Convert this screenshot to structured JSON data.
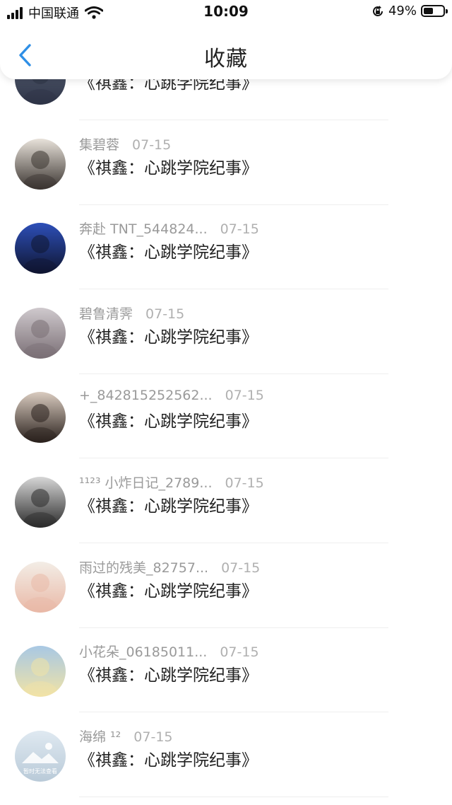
{
  "status_bar": {
    "carrier": "中国联通",
    "time": "10:09",
    "battery_percent": "49%",
    "battery_level": 0.49
  },
  "header": {
    "title": "收藏",
    "back_icon": "chevron-left-icon"
  },
  "items": [
    {
      "message": "《祺鑫：心跳学院纪事》",
      "avatar_colors": [
        "#5a6378",
        "#2e3446"
      ]
    },
    {
      "name": "集碧蓉",
      "date": "07-15",
      "message": "《祺鑫：心跳学院纪事》",
      "avatar_colors": [
        "#e8e2da",
        "#3a3430"
      ]
    },
    {
      "name": "奔赴 TNT_544824...",
      "date": "07-15",
      "message": "《祺鑫：心跳学院纪事》",
      "avatar_colors": [
        "#2d4fb8",
        "#0f1530"
      ]
    },
    {
      "name": "碧鲁清霁",
      "date": "07-15",
      "message": "《祺鑫：心跳学院纪事》",
      "avatar_colors": [
        "#cfc9cd",
        "#7a6f75"
      ]
    },
    {
      "name": "+_842815252562...",
      "date": "07-15",
      "message": "《祺鑫：心跳学院纪事》",
      "avatar_colors": [
        "#d9cbbf",
        "#2a211d"
      ]
    },
    {
      "name": "¹¹²³ 小炸日记_2789...",
      "date": "07-15",
      "message": "《祺鑫：心跳学院纪事》",
      "avatar_colors": [
        "#d6d6d6",
        "#2b2b2b"
      ]
    },
    {
      "name": "雨过的残美_82757...",
      "date": "07-15",
      "message": "《祺鑫：心跳学院纪事》",
      "avatar_colors": [
        "#f3ede6",
        "#e9b9a7"
      ]
    },
    {
      "name": "小花朵_06185011...",
      "date": "07-15",
      "message": "《祺鑫：心跳学院纪事》",
      "avatar_colors": [
        "#a8c8e4",
        "#f1e3a6"
      ]
    },
    {
      "name": "海绵 ¹²",
      "date": "07-15",
      "message": "《祺鑫：心跳学院纪事》",
      "avatar_colors": [
        "#dfe9f1",
        "#b9cad8"
      ],
      "avatar_caption": "暂时无法查看"
    }
  ]
}
